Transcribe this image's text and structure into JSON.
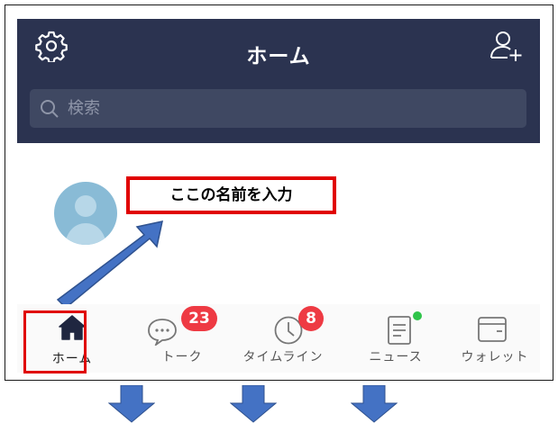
{
  "header": {
    "title": "ホーム",
    "settings_icon": "gear-icon",
    "add_friend_icon": "add-friend-icon"
  },
  "search": {
    "placeholder": "検索",
    "icon": "search-icon"
  },
  "profile": {
    "annotation_text": "ここの名前を入力",
    "annotation_color": "#e00000"
  },
  "tabs": [
    {
      "label": "ホーム",
      "icon": "home-icon",
      "active": true
    },
    {
      "label": "トーク",
      "icon": "chat-bubble-icon",
      "badge": "23"
    },
    {
      "label": "タイムライン",
      "icon": "clock-icon",
      "badge": "8"
    },
    {
      "label": "ニュース",
      "icon": "news-icon",
      "dot": true
    },
    {
      "label": "ウォレット",
      "icon": "wallet-icon"
    }
  ],
  "colors": {
    "header_bg": "#2b3350",
    "badge": "#ee3a43",
    "news_dot": "#2fc44a",
    "highlight": "#e00000",
    "arrow": "#4472c4"
  }
}
